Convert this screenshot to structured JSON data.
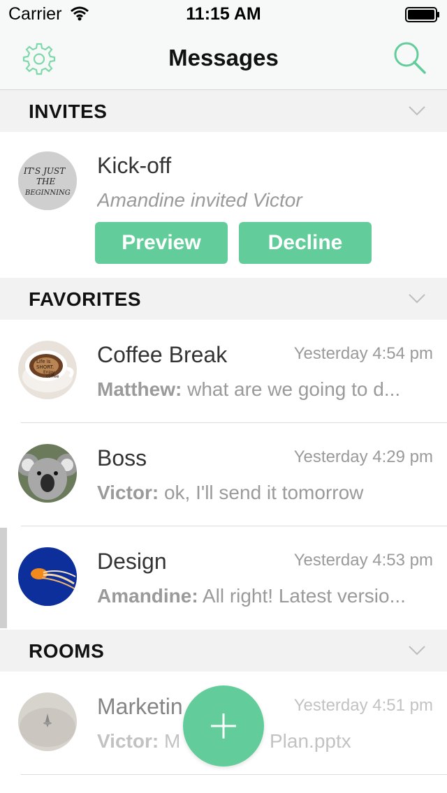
{
  "status_bar": {
    "carrier": "Carrier",
    "time": "11:15 AM"
  },
  "nav": {
    "title": "Messages",
    "settings_icon": "gear-icon",
    "search_icon": "search-icon"
  },
  "sections": {
    "invites": "INVITES",
    "favorites": "FAVORITES",
    "rooms": "ROOMS"
  },
  "invite": {
    "name": "Kick-off",
    "subtitle": "Amandine invited Victor",
    "avatar_text": [
      "IT'S JUST",
      "THE",
      "BEGINNING"
    ],
    "preview_label": "Preview",
    "decline_label": "Decline"
  },
  "favorites": [
    {
      "name": "Coffee Break",
      "time": "Yesterday 4:54 pm",
      "sender": "Matthew:",
      "message": "what are we going to d...",
      "avatar_text": [
        "Life is",
        "SHORT.",
        "Enjoy",
        "coffee"
      ]
    },
    {
      "name": "Boss",
      "time": "Yesterday 4:29 pm",
      "sender": "Victor:",
      "message": "ok, I'll send it tomorrow"
    },
    {
      "name": "Design",
      "time": "Yesterday 4:53 pm",
      "sender": "Amandine:",
      "message": "All right! Latest versio..."
    }
  ],
  "rooms": [
    {
      "name": "Marketin",
      "time": "Yesterday 4:51 pm",
      "sender": "Victor:",
      "message_left": "M",
      "message_right": "Plan.pptx"
    }
  ],
  "colors": {
    "accent": "#62cd9a",
    "section_bg": "#f2f2f2",
    "muted_text": "#9a9a9a"
  },
  "fab": {
    "icon": "plus-icon"
  }
}
